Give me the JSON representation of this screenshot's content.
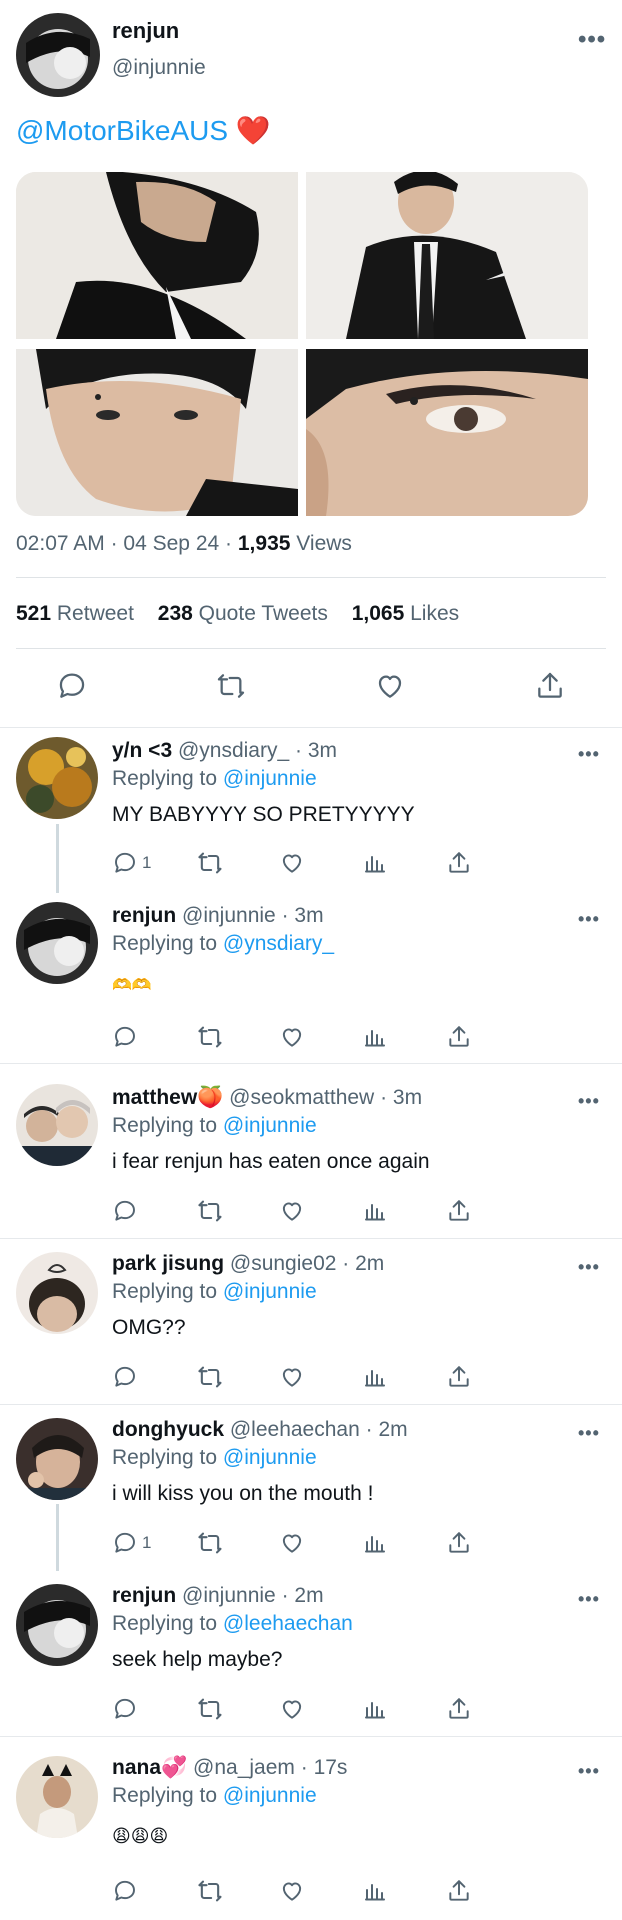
{
  "main": {
    "name": "renjun",
    "handle": "@injunnie",
    "mention": "@MotorBikeAUS",
    "emoji": "❤️",
    "time": "02:07 AM",
    "date": "04 Sep 24",
    "views_count": "1,935",
    "views_label": "Views",
    "retweets_count": "521",
    "retweets_label": "Retweet",
    "quotes_count": "238",
    "quotes_label": "Quote Tweets",
    "likes_count": "1,065",
    "likes_label": "Likes"
  },
  "replies": [
    {
      "name": "y/n <3",
      "handle": "@ynsdiary_",
      "time": "3m",
      "replying_label": "Replying to",
      "replying_to": "@injunnie",
      "text": "MY BABYYYY SO PRETYYYYY",
      "reply_count": "1"
    },
    {
      "name": "renjun",
      "handle": "@injunnie",
      "time": "3m",
      "replying_label": "Replying to",
      "replying_to": "@ynsdiary_",
      "text": "🫶🫶",
      "reply_count": ""
    },
    {
      "name": "matthew🍑",
      "handle": "@seokmatthew",
      "time": "3m",
      "replying_label": "Replying to",
      "replying_to": "@injunnie",
      "text": "i fear renjun has eaten once again",
      "reply_count": ""
    },
    {
      "name": "park jisung",
      "handle": "@sungie02",
      "time": "2m",
      "replying_label": "Replying to",
      "replying_to": "@injunnie",
      "text": "OMG??",
      "reply_count": ""
    },
    {
      "name": "donghyuck",
      "handle": "@leehaechan",
      "time": "2m",
      "replying_label": "Replying to",
      "replying_to": "@injunnie",
      "text": "i will kiss you on the mouth !",
      "reply_count": "1"
    },
    {
      "name": "renjun",
      "handle": "@injunnie",
      "time": "2m",
      "replying_label": "Replying to",
      "replying_to": "@leehaechan",
      "text": "seek help maybe?",
      "reply_count": ""
    },
    {
      "name": "nana💞",
      "handle": "@na_jaem",
      "time": "17s",
      "replying_label": "Replying to",
      "replying_to": "@injunnie",
      "text": "😩😩😩",
      "reply_count": ""
    }
  ],
  "ui": {
    "more": "•••",
    "dot": "·"
  },
  "icons": {
    "reply": "speech-bubble-icon",
    "retweet": "retweet-icon",
    "like": "heart-icon",
    "views": "bar-chart-icon",
    "share": "share-icon"
  },
  "colors": {
    "accent": "#1d9bf0",
    "secondary_text": "#536471",
    "primary_text": "#0f1419",
    "divider": "#e6e9ec"
  }
}
